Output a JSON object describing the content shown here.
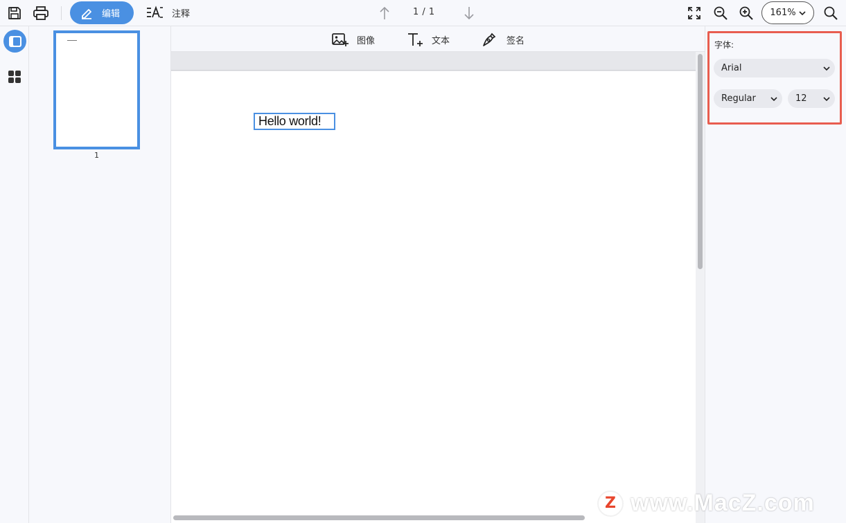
{
  "toolbar": {
    "edit_label": "编辑",
    "annotate_label": "注释",
    "page_indicator": "1 / 1",
    "zoom_value": "161%"
  },
  "doc_tools": {
    "image_label": "图像",
    "text_label": "文本",
    "signature_label": "签名"
  },
  "thumbnails": {
    "page_number": "1"
  },
  "document": {
    "textbox_content": "Hello world!"
  },
  "font_panel": {
    "label": "字体:",
    "family": "Arial",
    "style": "Regular",
    "size": "12"
  },
  "watermark": {
    "badge": "Z",
    "text": "www.MacZ.com"
  },
  "colors": {
    "accent": "#4a90e2",
    "highlight": "#e85d4f",
    "watermark_badge": "#e8452c"
  }
}
